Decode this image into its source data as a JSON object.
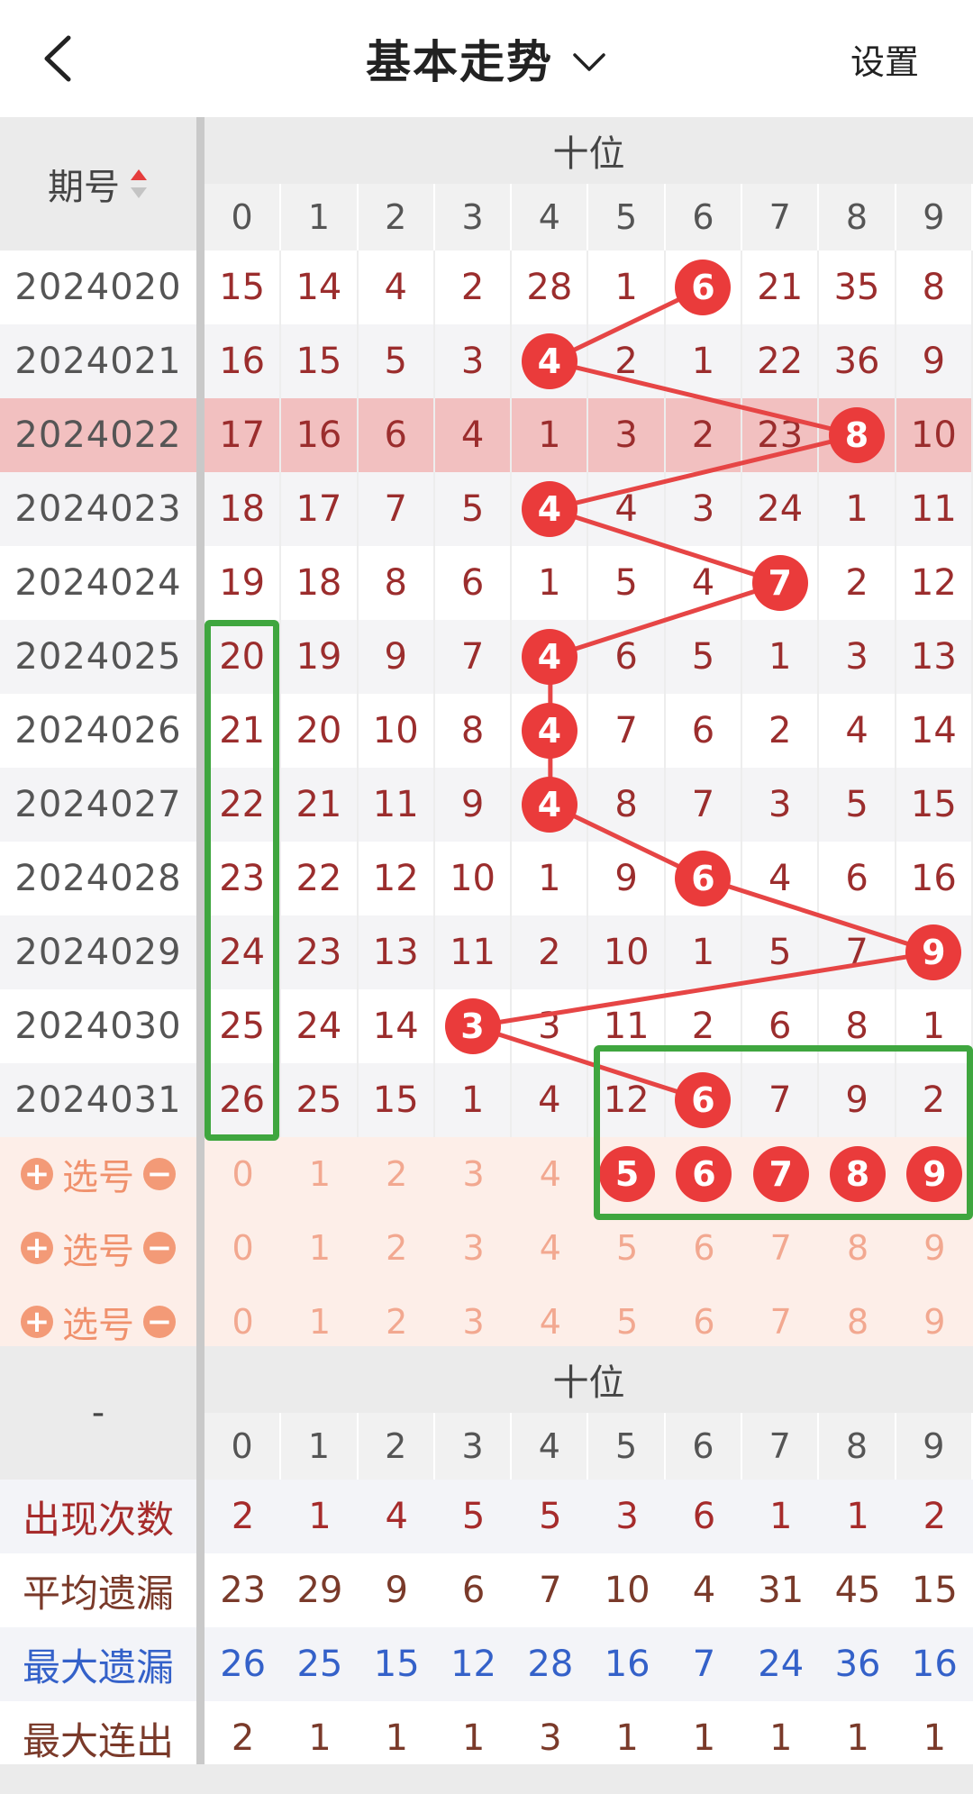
{
  "header": {
    "title": "基本走势",
    "settings_label": "设置"
  },
  "table": {
    "issue_col_label": "期号",
    "group_label": "十位",
    "digits": [
      "0",
      "1",
      "2",
      "3",
      "4",
      "5",
      "6",
      "7",
      "8",
      "9"
    ],
    "rows": [
      {
        "issue": "2024020",
        "winning_digit": 6,
        "cells": [
          "15",
          "14",
          "4",
          "2",
          "28",
          "1",
          "6",
          "21",
          "35",
          "8"
        ]
      },
      {
        "issue": "2024021",
        "winning_digit": 4,
        "cells": [
          "16",
          "15",
          "5",
          "3",
          "4",
          "2",
          "1",
          "22",
          "36",
          "9"
        ]
      },
      {
        "issue": "2024022",
        "winning_digit": 8,
        "cells": [
          "17",
          "16",
          "6",
          "4",
          "1",
          "3",
          "2",
          "23",
          "8",
          "10"
        ],
        "highlighted": true
      },
      {
        "issue": "2024023",
        "winning_digit": 4,
        "cells": [
          "18",
          "17",
          "7",
          "5",
          "4",
          "4",
          "3",
          "24",
          "1",
          "11"
        ]
      },
      {
        "issue": "2024024",
        "winning_digit": 7,
        "cells": [
          "19",
          "18",
          "8",
          "6",
          "1",
          "5",
          "4",
          "7",
          "2",
          "12"
        ]
      },
      {
        "issue": "2024025",
        "winning_digit": 4,
        "cells": [
          "20",
          "19",
          "9",
          "7",
          "4",
          "6",
          "5",
          "1",
          "3",
          "13"
        ]
      },
      {
        "issue": "2024026",
        "winning_digit": 4,
        "cells": [
          "21",
          "20",
          "10",
          "8",
          "4",
          "7",
          "6",
          "2",
          "4",
          "14"
        ]
      },
      {
        "issue": "2024027",
        "winning_digit": 4,
        "cells": [
          "22",
          "21",
          "11",
          "9",
          "4",
          "8",
          "7",
          "3",
          "5",
          "15"
        ]
      },
      {
        "issue": "2024028",
        "winning_digit": 6,
        "cells": [
          "23",
          "22",
          "12",
          "10",
          "1",
          "9",
          "6",
          "4",
          "6",
          "16"
        ]
      },
      {
        "issue": "2024029",
        "winning_digit": 9,
        "cells": [
          "24",
          "23",
          "13",
          "11",
          "2",
          "10",
          "1",
          "5",
          "7",
          "9"
        ]
      },
      {
        "issue": "2024030",
        "winning_digit": 3,
        "cells": [
          "25",
          "24",
          "14",
          "3",
          "3",
          "11",
          "2",
          "6",
          "8",
          "1"
        ]
      },
      {
        "issue": "2024031",
        "winning_digit": 6,
        "cells": [
          "26",
          "25",
          "15",
          "1",
          "4",
          "12",
          "6",
          "7",
          "9",
          "2"
        ]
      }
    ],
    "pick_rows": [
      {
        "label": "选号",
        "selected": [
          5,
          6,
          7,
          8,
          9
        ]
      },
      {
        "label": "选号",
        "selected": []
      },
      {
        "label": "选号",
        "selected": []
      }
    ]
  },
  "stats": {
    "group_label": "十位",
    "corner_label": "-",
    "rows": [
      {
        "label": "出现次数",
        "color": "#a62b2b",
        "values": [
          "2",
          "1",
          "4",
          "5",
          "5",
          "3",
          "6",
          "1",
          "1",
          "2"
        ]
      },
      {
        "label": "平均遗漏",
        "color": "#7a3a2a",
        "values": [
          "23",
          "29",
          "9",
          "6",
          "7",
          "10",
          "4",
          "31",
          "45",
          "15"
        ]
      },
      {
        "label": "最大遗漏",
        "color": "#3461c9",
        "values": [
          "26",
          "25",
          "15",
          "12",
          "28",
          "16",
          "7",
          "24",
          "36",
          "16"
        ]
      },
      {
        "label": "最大连出",
        "color": "#7a3a2a",
        "values": [
          "2",
          "1",
          "1",
          "1",
          "3",
          "1",
          "1",
          "1",
          "1",
          "1"
        ]
      }
    ]
  },
  "colors": {
    "ball": "#ea3b3b",
    "highlight_row": "#f2c0c0",
    "pick_bg": "#fdeee8",
    "annotation_box": "#3fa63f"
  }
}
